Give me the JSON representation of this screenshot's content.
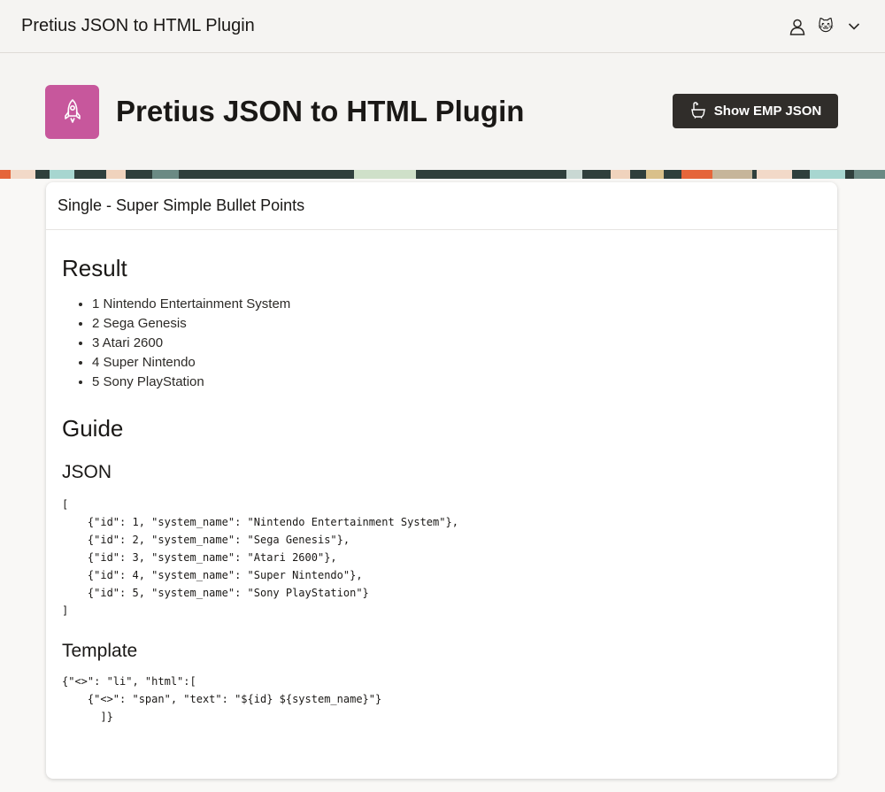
{
  "app": {
    "title": "Pretius JSON to HTML Plugin",
    "avatar_emoji": "🐱"
  },
  "hero": {
    "title": "Pretius JSON to HTML Plugin",
    "button_label": "Show EMP JSON"
  },
  "card": {
    "title": "Single - Super Simple Bullet Points",
    "result_heading": "Result",
    "items": [
      "1 Nintendo Entertainment System",
      "2 Sega Genesis",
      "3 Atari 2600",
      "4 Super Nintendo",
      "5 Sony PlayStation"
    ],
    "guide_heading": "Guide",
    "json_heading": "JSON",
    "json_code": "[\n    {\"id\": 1, \"system_name\": \"Nintendo Entertainment System\"},\n    {\"id\": 2, \"system_name\": \"Sega Genesis\"},\n    {\"id\": 3, \"system_name\": \"Atari 2600\"},\n    {\"id\": 4, \"system_name\": \"Super Nintendo\"},\n    {\"id\": 5, \"system_name\": \"Sony PlayStation\"}\n]",
    "template_heading": "Template",
    "template_code": "{\"<>\": \"li\", \"html\":[\n    {\"<>\": \"span\", \"text\": \"${id} ${system_name}\"}\n      ]}"
  },
  "colors": {
    "hero_icon_bg": "#c7579c",
    "button_bg": "#302d2a"
  }
}
